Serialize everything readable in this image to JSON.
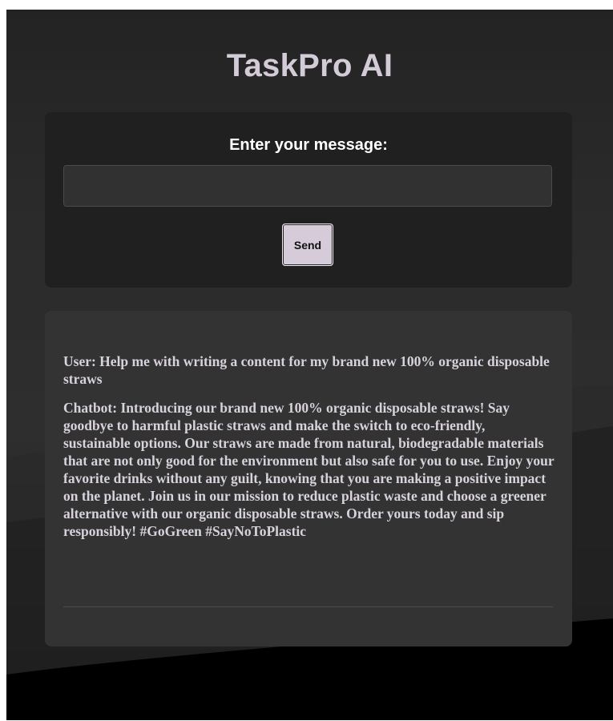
{
  "app": {
    "title": "TaskPro AI"
  },
  "form": {
    "label": "Enter your message:",
    "input_value": "",
    "send_label": "Send"
  },
  "chat": {
    "messages": [
      {
        "sender": "User",
        "text": "User: Help me with writing a content for my brand new 100% organic disposable straws"
      },
      {
        "sender": "Chatbot",
        "text": "Chatbot: Introducing our brand new 100% organic disposable straws! Say goodbye to harmful plastic straws and make the switch to eco-friendly, sustainable options. Our straws are made from natural, biodegradable materials that are not only good for the environment but also safe for you to use. Enjoy your favorite drinks without any guilt, knowing that you are making a positive impact on the planet. Join us in our mission to reduce plastic waste and choose a greener alternative with our organic disposable straws. Order yours today and sip responsibly! #GoGreen #SayNoToPlastic"
      }
    ]
  },
  "colors": {
    "title": "#d4cbd8",
    "button_bg": "#d6cbd8",
    "input_card_bg": "#202020",
    "chat_card_bg": "#333333",
    "chat_text": "#d8d2dc"
  }
}
